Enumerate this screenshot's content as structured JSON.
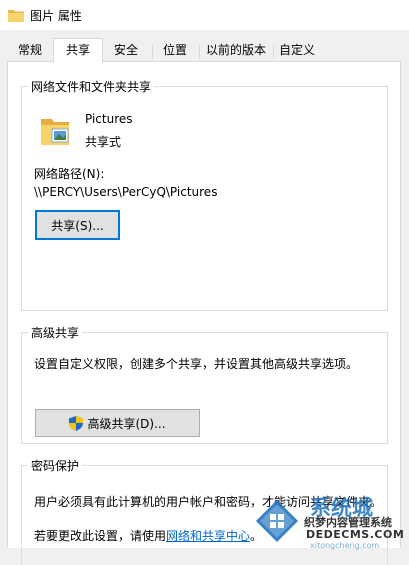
{
  "window": {
    "title": "图片 属性",
    "icon": "folder-icon"
  },
  "tabs": [
    {
      "label": "常规",
      "active": false
    },
    {
      "label": "共享",
      "active": true
    },
    {
      "label": "安全",
      "active": false
    },
    {
      "label": "位置",
      "active": false
    },
    {
      "label": "以前的版本",
      "active": false
    },
    {
      "label": "自定义",
      "active": false
    }
  ],
  "network_sharing": {
    "group_title": "网络文件和文件夹共享",
    "folder_name": "Pictures",
    "share_status": "共享式",
    "path_label": "网络路径(N):",
    "path_value": "\\\\PERCY\\Users\\PerCyQ\\Pictures",
    "share_button": "共享(S)..."
  },
  "advanced_sharing": {
    "group_title": "高级共享",
    "description": "设置自定义权限，创建多个共享，并设置其他高级共享选项。",
    "button": "高级共享(D)...",
    "button_icon": "uac-shield-icon"
  },
  "password_protection": {
    "group_title": "密码保护",
    "description": "用户必须具有此计算机的用户帐户和密码，才能访问共享文件夹。",
    "change_prefix": "若要更改此设置，请使用",
    "link_text": "网络和共享中心",
    "change_suffix": "。"
  },
  "watermark": {
    "brand": "系统城",
    "slogan": "织梦内容管理系统",
    "domain": "DEDECMS.COM",
    "domain_sub": "xitongcheng.com"
  },
  "colors": {
    "accent": "#0078d7",
    "link": "#0066cc",
    "watermark_blue": "#1e73be"
  }
}
